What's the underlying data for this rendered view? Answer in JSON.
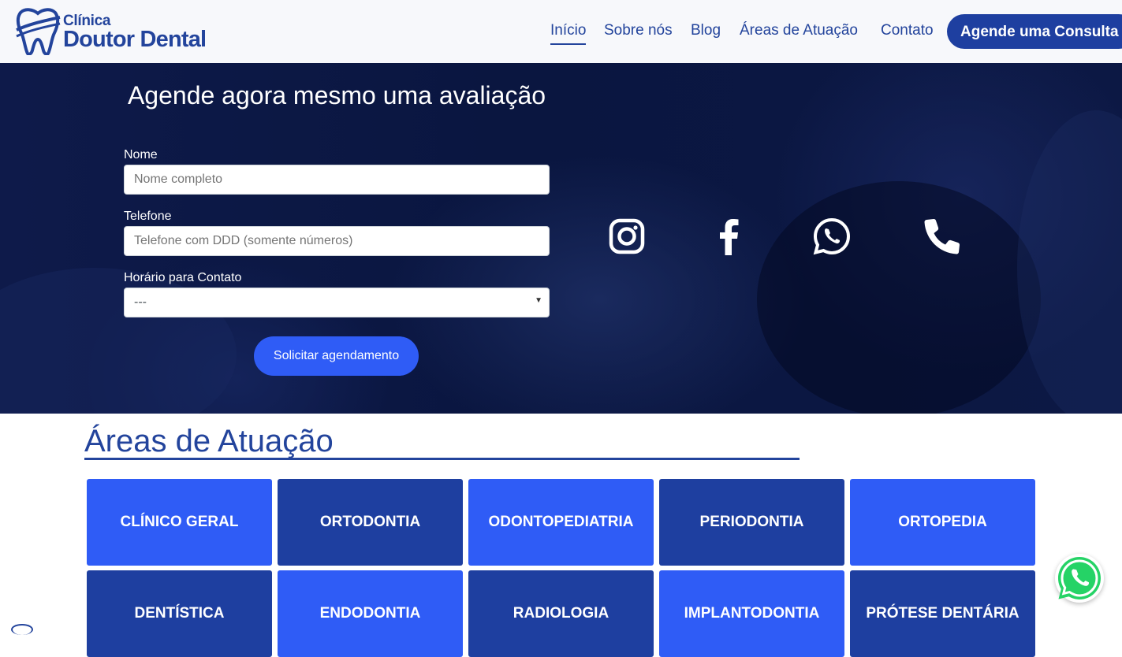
{
  "header": {
    "logo": {
      "small": "Clínica",
      "big": "Doutor Dental"
    },
    "nav": [
      {
        "label": "Início",
        "active": true
      },
      {
        "label": "Sobre nós",
        "active": false
      },
      {
        "label": "Blog",
        "active": false
      },
      {
        "label": "Áreas de Atuação",
        "active": false
      },
      {
        "label": "Contato",
        "active": false
      }
    ],
    "cta": "Agende uma Consulta"
  },
  "hero": {
    "title": "Agende agora mesmo uma avaliação",
    "form": {
      "name_label": "Nome",
      "name_placeholder": "Nome completo",
      "phone_label": "Telefone",
      "phone_placeholder": "Telefone com DDD (somente números)",
      "time_label": "Horário para Contato",
      "time_selected": "---",
      "submit": "Solicitar agendamento"
    },
    "social_icons": [
      "instagram-icon",
      "facebook-icon",
      "whatsapp-icon",
      "phone-icon"
    ]
  },
  "areas": {
    "title": "Áreas de Atuação",
    "tiles": [
      "CLÍNICO GERAL",
      "ORTODONTIA",
      "ODONTOPEDIATRIA",
      "PERIODONTIA",
      "ORTOPEDIA",
      "DENTÍSTICA",
      "ENDODONTIA",
      "RADIOLOGIA",
      "IMPLANTODONTIA",
      "PRÓTESE DENTÁRIA"
    ]
  },
  "colors": {
    "brand": "#23449c",
    "tile_light": "#2f5cf6",
    "tile_dark": "#1e3fa0",
    "whatsapp": "#25d366"
  }
}
